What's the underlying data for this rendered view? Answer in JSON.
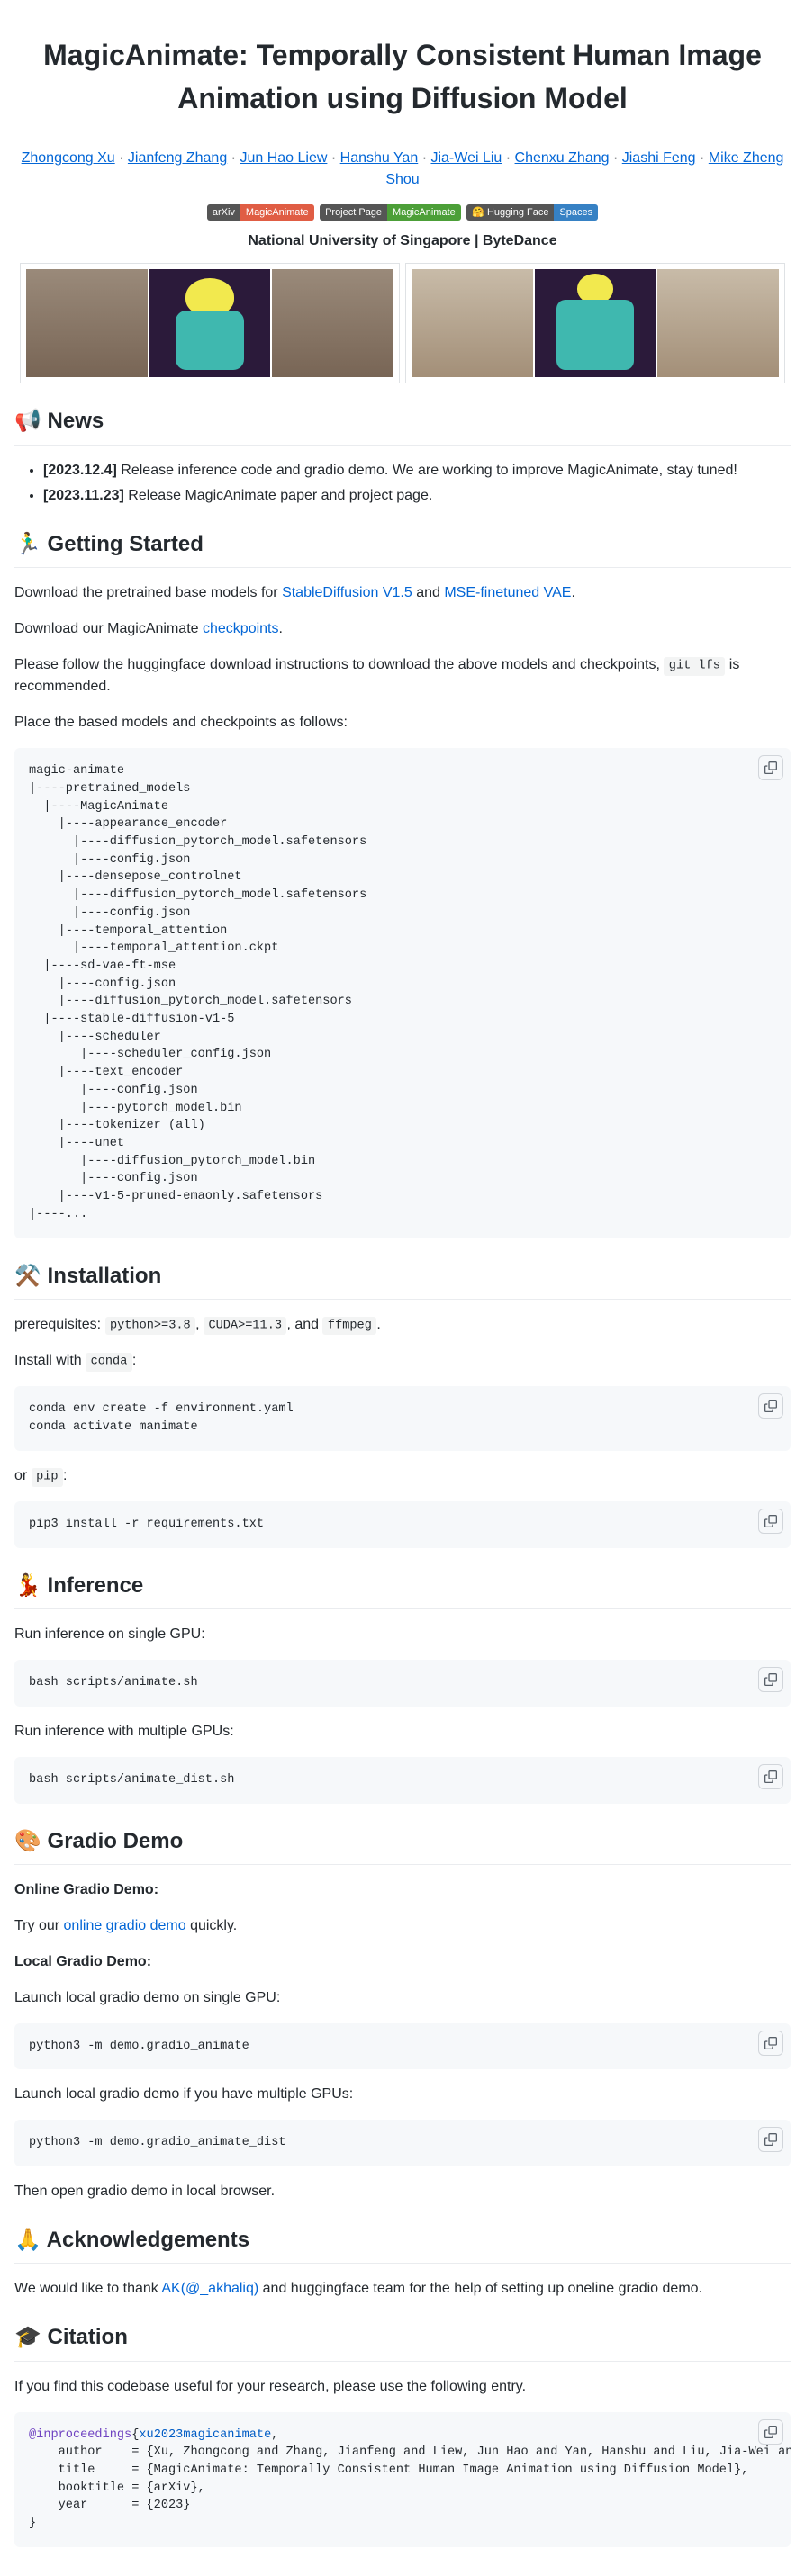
{
  "title": "MagicAnimate: Temporally Consistent Human Image Animation using Diffusion Model",
  "authors": [
    "Zhongcong Xu",
    "Jianfeng Zhang",
    "Jun Hao Liew",
    "Hanshu Yan",
    "Jia-Wei Liu",
    "Chenxu Zhang",
    "Jiashi Feng",
    "Mike Zheng Shou"
  ],
  "badges": [
    {
      "left": "arXiv",
      "right": "MagicAnimate",
      "color": "#e05d44"
    },
    {
      "left": "Project Page",
      "right": "MagicAnimate",
      "color": "#4c9f38"
    },
    {
      "left": "🤗 Hugging Face",
      "right": "Spaces",
      "color": "#3681c4"
    }
  ],
  "affiliation": "National University of Singapore   |   ByteDance",
  "news": {
    "heading": "📢 News",
    "items": [
      {
        "date": "[2023.12.4]",
        "text": " Release inference code and gradio demo. We are working to improve MagicAnimate, stay tuned!"
      },
      {
        "date": "[2023.11.23]",
        "text": " Release MagicAnimate paper and project page."
      }
    ]
  },
  "getting_started": {
    "heading": "🏃‍♂️ Getting Started",
    "p1a": "Download the pretrained base models for ",
    "link1": "StableDiffusion V1.5",
    "p1b": " and ",
    "link2": "MSE-finetuned VAE",
    "p1c": ".",
    "p2a": "Download our MagicAnimate ",
    "link3": "checkpoints",
    "p2b": ".",
    "p3a": "Please follow the huggingface download instructions to download the above models and checkpoints, ",
    "code_gitlfs": "git lfs",
    "p3b": " is recommended.",
    "p4": "Place the based models and checkpoints as follows:",
    "tree": "magic-animate\n|----pretrained_models\n  |----MagicAnimate\n    |----appearance_encoder\n      |----diffusion_pytorch_model.safetensors\n      |----config.json\n    |----densepose_controlnet\n      |----diffusion_pytorch_model.safetensors\n      |----config.json\n    |----temporal_attention\n      |----temporal_attention.ckpt\n  |----sd-vae-ft-mse\n    |----config.json\n    |----diffusion_pytorch_model.safetensors\n  |----stable-diffusion-v1-5\n    |----scheduler\n       |----scheduler_config.json\n    |----text_encoder\n       |----config.json\n       |----pytorch_model.bin\n    |----tokenizer (all)\n    |----unet\n       |----diffusion_pytorch_model.bin\n       |----config.json\n    |----v1-5-pruned-emaonly.safetensors\n|----..."
  },
  "installation": {
    "heading": "⚒️ Installation",
    "p1a": "prerequisites: ",
    "req1": "python>=3.8",
    "sep1": ", ",
    "req2": "CUDA>=11.3",
    "sep2": ", and ",
    "req3": "ffmpeg",
    "sep3": ".",
    "p2a": "Install with ",
    "conda_code": "conda",
    "p2b": ":",
    "conda_block": "conda env create -f environment.yaml\nconda activate manimate",
    "p3a": "or ",
    "pip_code": "pip",
    "p3b": ":",
    "pip_block": "pip3 install -r requirements.txt"
  },
  "inference": {
    "heading": "💃 Inference",
    "p1": "Run inference on single GPU:",
    "code1": "bash scripts/animate.sh",
    "p2": "Run inference with multiple GPUs:",
    "code2": "bash scripts/animate_dist.sh"
  },
  "gradio": {
    "heading": "🎨 Gradio Demo",
    "online_h": "Online Gradio Demo:",
    "p1a": "Try our ",
    "link": "online gradio demo",
    "p1b": " quickly.",
    "local_h": "Local Gradio Demo:",
    "p2": "Launch local gradio demo on single GPU:",
    "code1": "python3 -m demo.gradio_animate",
    "p3": "Launch local gradio demo if you have multiple GPUs:",
    "code2": "python3 -m demo.gradio_animate_dist",
    "p4": "Then open gradio demo in local browser."
  },
  "ack": {
    "heading": "🙏 Acknowledgements",
    "p1a": "We would like to thank ",
    "link": "AK(@_akhaliq)",
    "p1b": " and huggingface team for the help of setting up oneline gradio demo."
  },
  "citation": {
    "heading": "🎓 Citation",
    "p1": "If you find this codebase useful for your research, please use the following entry.",
    "bib_kw": "@inproceedings",
    "bib_fn": "xu2023magicanimate",
    "bib_body": ",\n    author    = {Xu, Zhongcong and Zhang, Jianfeng and Liew, Jun Hao and Yan, Hanshu and Liu, Jia-Wei and Zhang, Chenxu and Feng, Jiashi and Shou, Mike Zheng},\n    title     = {MagicAnimate: Temporally Consistent Human Image Animation using Diffusion Model},\n    booktitle = {arXiv},\n    year      = {2023}\n}"
  }
}
